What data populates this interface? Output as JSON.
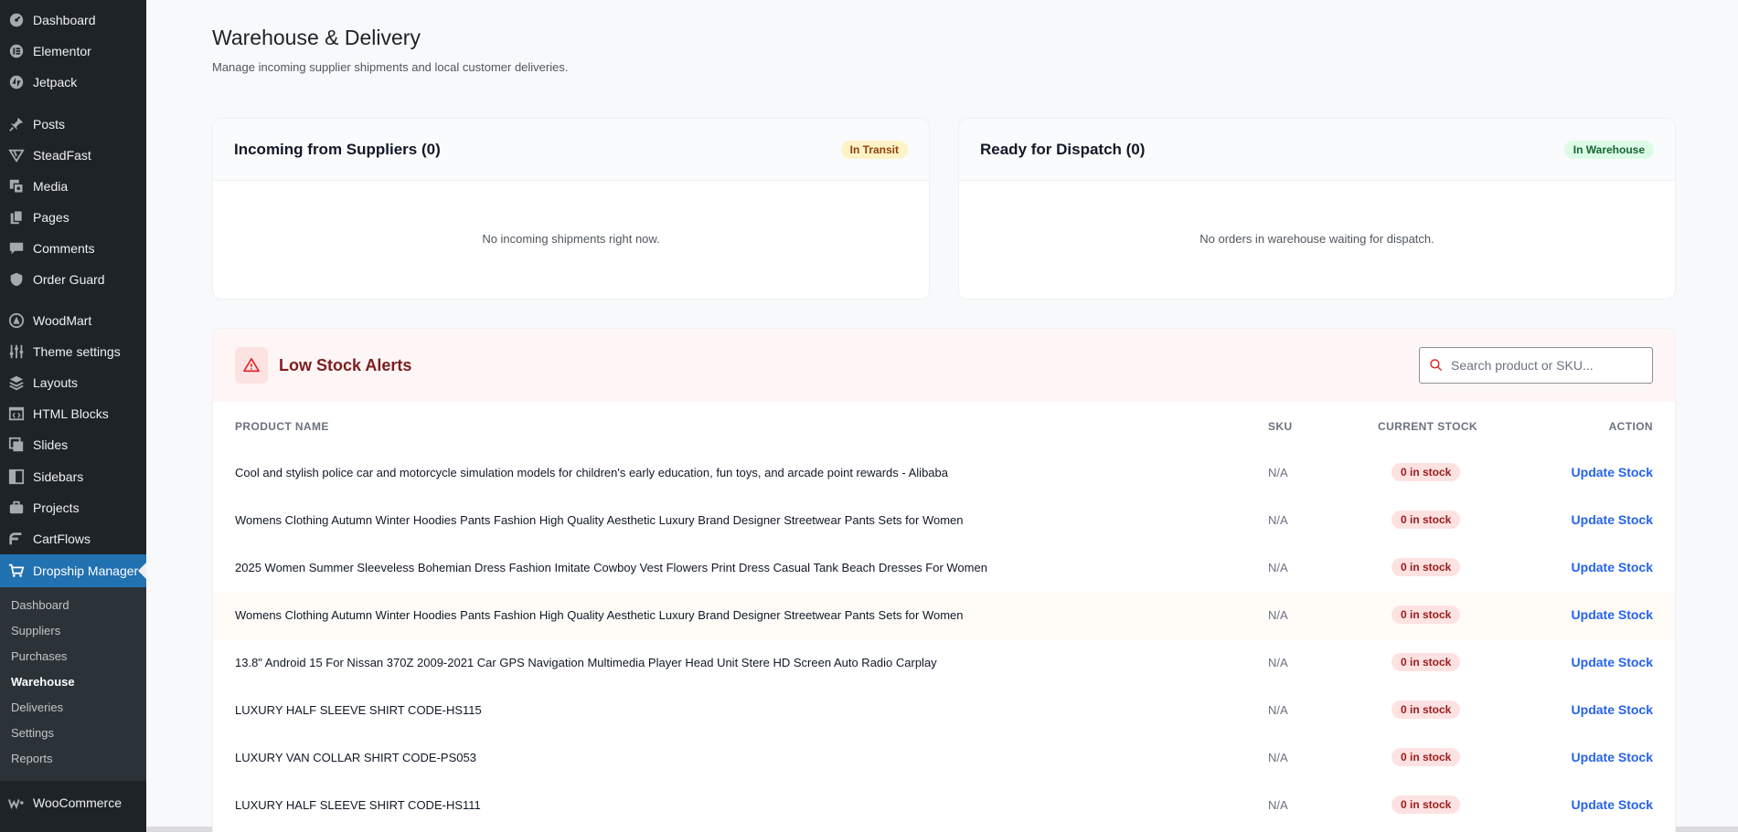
{
  "sidebar": {
    "items": [
      {
        "label": "Dashboard",
        "icon": "dashboard-icon"
      },
      {
        "label": "Elementor",
        "icon": "elementor-icon"
      },
      {
        "label": "Jetpack",
        "icon": "jetpack-icon"
      },
      {
        "label": "Posts",
        "icon": "pin-icon"
      },
      {
        "label": "SteadFast",
        "icon": "steadfast-icon"
      },
      {
        "label": "Media",
        "icon": "media-icon"
      },
      {
        "label": "Pages",
        "icon": "pages-icon"
      },
      {
        "label": "Comments",
        "icon": "comments-icon"
      },
      {
        "label": "Order Guard",
        "icon": "shield-icon"
      },
      {
        "label": "WoodMart",
        "icon": "woodmart-icon"
      },
      {
        "label": "Theme settings",
        "icon": "sliders-icon"
      },
      {
        "label": "Layouts",
        "icon": "layers-icon"
      },
      {
        "label": "HTML Blocks",
        "icon": "code-block-icon"
      },
      {
        "label": "Slides",
        "icon": "slides-icon"
      },
      {
        "label": "Sidebars",
        "icon": "sidebar-icon"
      },
      {
        "label": "Projects",
        "icon": "briefcase-icon"
      },
      {
        "label": "CartFlows",
        "icon": "cartflows-icon"
      },
      {
        "label": "Dropship Manager",
        "icon": "cart-icon"
      }
    ],
    "submenu": [
      "Dashboard",
      "Suppliers",
      "Purchases",
      "Warehouse",
      "Deliveries",
      "Settings",
      "Reports"
    ],
    "woocommerce": "WooCommerce"
  },
  "header": {
    "title": "Warehouse & Delivery",
    "subtitle": "Manage incoming supplier shipments and local customer deliveries."
  },
  "incoming": {
    "title": "Incoming from Suppliers (0)",
    "badge": "In Transit",
    "empty": "No incoming shipments right now."
  },
  "dispatch": {
    "title": "Ready for Dispatch (0)",
    "badge": "In Warehouse",
    "empty": "No orders in warehouse waiting for dispatch."
  },
  "alerts": {
    "title": "Low Stock Alerts",
    "search_placeholder": "Search product or SKU...",
    "columns": {
      "name": "PRODUCT NAME",
      "sku": "SKU",
      "stock": "CURRENT STOCK",
      "action": "ACTION"
    },
    "rows": [
      {
        "name": "Cool and stylish police car and motorcycle simulation models for children's early education, fun toys, and arcade point rewards - Alibaba",
        "sku": "N/A",
        "stock": "0 in stock",
        "action": "Update Stock"
      },
      {
        "name": "Womens Clothing Autumn Winter Hoodies Pants Fashion High Quality Aesthetic Luxury Brand Designer Streetwear Pants Sets for Women",
        "sku": "N/A",
        "stock": "0 in stock",
        "action": "Update Stock"
      },
      {
        "name": "2025 Women Summer Sleeveless Bohemian Dress Fashion Imitate Cowboy Vest Flowers Print Dress Casual Tank Beach Dresses For Women",
        "sku": "N/A",
        "stock": "0 in stock",
        "action": "Update Stock"
      },
      {
        "name": "Womens Clothing Autumn Winter Hoodies Pants Fashion High Quality Aesthetic Luxury Brand Designer Streetwear Pants Sets for Women",
        "sku": "N/A",
        "stock": "0 in stock",
        "action": "Update Stock"
      },
      {
        "name": "13.8\" Android 15 For Nissan 370Z 2009-2021 Car GPS Navigation Multimedia Player Head Unit Stere HD Screen Auto Radio Carplay",
        "sku": "N/A",
        "stock": "0 in stock",
        "action": "Update Stock"
      },
      {
        "name": "LUXURY HALF SLEEVE SHIRT CODE-HS115",
        "sku": "N/A",
        "stock": "0 in stock",
        "action": "Update Stock"
      },
      {
        "name": "LUXURY VAN COLLAR SHIRT CODE-PS053",
        "sku": "N/A",
        "stock": "0 in stock",
        "action": "Update Stock"
      },
      {
        "name": "LUXURY HALF SLEEVE SHIRT CODE-HS111",
        "sku": "N/A",
        "stock": "0 in stock",
        "action": "Update Stock"
      }
    ]
  },
  "colors": {
    "sidebar_bg": "#1d2327",
    "active_menu": "#2271b1",
    "link": "#2563eb",
    "alert_title": "#7f1d1d"
  }
}
